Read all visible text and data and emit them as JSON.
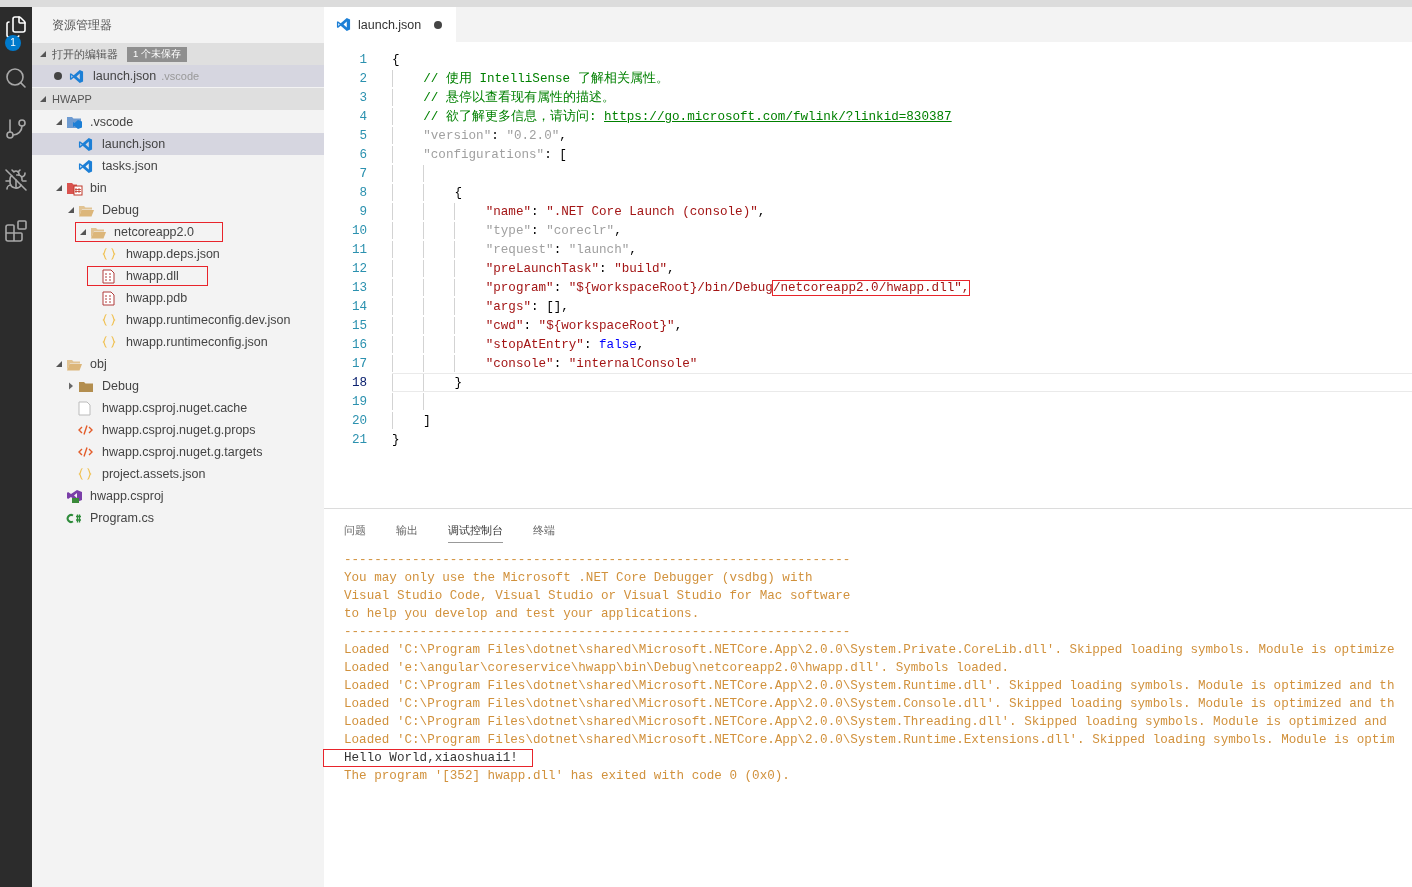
{
  "activity_bar": {
    "items": [
      {
        "kind": "files",
        "selected": true,
        "badge": "1"
      },
      {
        "kind": "search",
        "selected": false
      },
      {
        "kind": "git",
        "selected": false
      },
      {
        "kind": "debug",
        "selected": false
      },
      {
        "kind": "extensions",
        "selected": false
      }
    ]
  },
  "sidebar": {
    "title": "资源管理器",
    "open_editors": {
      "title": "打开的编辑器",
      "badge": "1 个未保存",
      "expanded": true,
      "items": [
        {
          "label": "launch.json",
          "description": ".vscode",
          "kind": "vscode",
          "dirty": true,
          "selected": true
        }
      ]
    },
    "workspace": {
      "title": "HWAPP",
      "expanded": true,
      "tree": [
        {
          "label": ".vscode",
          "kind": "vscode-folder",
          "expanded": true,
          "selected": false,
          "children": [
            {
              "label": "launch.json",
              "kind": "vscode",
              "selected": true
            },
            {
              "label": "tasks.json",
              "kind": "vscode",
              "selected": false
            }
          ]
        },
        {
          "label": "bin",
          "kind": "bin-folder",
          "expanded": true,
          "selected": false,
          "children": [
            {
              "label": "Debug",
              "kind": "folder",
              "expanded": true,
              "selected": false,
              "children": [
                {
                  "label": "netcoreapp2.0",
                  "kind": "folder",
                  "expanded": true,
                  "selected": false,
                  "annotated": true,
                  "children": [
                    {
                      "label": "hwapp.deps.json",
                      "kind": "braces",
                      "selected": false
                    },
                    {
                      "label": "hwapp.dll",
                      "kind": "binary",
                      "selected": false,
                      "annotated": true
                    },
                    {
                      "label": "hwapp.pdb",
                      "kind": "binary",
                      "selected": false
                    },
                    {
                      "label": "hwapp.runtimeconfig.dev.json",
                      "kind": "braces",
                      "selected": false
                    },
                    {
                      "label": "hwapp.runtimeconfig.json",
                      "kind": "braces",
                      "selected": false
                    }
                  ]
                }
              ]
            }
          ]
        },
        {
          "label": "obj",
          "kind": "folder",
          "expanded": true,
          "selected": false,
          "children": [
            {
              "label": "Debug",
              "kind": "folder",
              "expanded": false,
              "selected": false
            },
            {
              "label": "hwapp.csproj.nuget.cache",
              "kind": "plain",
              "selected": false
            },
            {
              "label": "hwapp.csproj.nuget.g.props",
              "kind": "xml",
              "selected": false
            },
            {
              "label": "hwapp.csproj.nuget.g.targets",
              "kind": "xml",
              "selected": false
            },
            {
              "label": "project.assets.json",
              "kind": "braces",
              "selected": false
            }
          ]
        },
        {
          "label": "hwapp.csproj",
          "kind": "csproj",
          "selected": false
        },
        {
          "label": "Program.cs",
          "kind": "csharp",
          "selected": false
        }
      ]
    }
  },
  "editor": {
    "tabs": [
      {
        "label": "launch.json",
        "kind": "vscode",
        "dirty": true,
        "selected": true
      }
    ],
    "lines": [
      {
        "number": "1",
        "tokens": [
          {
            "kind": "punct",
            "text": "{"
          }
        ],
        "children": [
          {
            "number": "2",
            "tokens": [
              {
                "kind": "comment",
                "text": "// 使用 IntelliSense 了解相关属性。"
              }
            ]
          },
          {
            "number": "3",
            "tokens": [
              {
                "kind": "comment",
                "text": "// 悬停以查看现有属性的描述。"
              }
            ]
          },
          {
            "number": "4",
            "tokens": [
              {
                "kind": "comment",
                "text": "// 欲了解更多信息，请访问: "
              },
              {
                "kind": "link",
                "text": "https://go.microsoft.com/fwlink/?linkid=830387"
              }
            ]
          },
          {
            "number": "5",
            "tokens": [
              {
                "kind": "dim",
                "text": "\"version\""
              },
              {
                "kind": "punct",
                "text": ": "
              },
              {
                "kind": "dim",
                "text": "\"0.2.0\""
              },
              {
                "kind": "punct",
                "text": ","
              }
            ]
          },
          {
            "number": "6",
            "tokens": [
              {
                "kind": "dim",
                "text": "\"configurations\""
              },
              {
                "kind": "punct",
                "text": ": ["
              }
            ],
            "children": [
              {
                "number": "7"
              },
              {
                "number": "8",
                "tokens": [
                  {
                    "kind": "punct",
                    "text": "{"
                  }
                ],
                "children": [
                  {
                    "number": "9",
                    "tokens": [
                      {
                        "kind": "key",
                        "text": "\"name\""
                      },
                      {
                        "kind": "punct",
                        "text": ": "
                      },
                      {
                        "kind": "string",
                        "text": "\".NET Core Launch (console)\""
                      },
                      {
                        "kind": "punct",
                        "text": ","
                      }
                    ]
                  },
                  {
                    "number": "10",
                    "tokens": [
                      {
                        "kind": "dim",
                        "text": "\"type\""
                      },
                      {
                        "kind": "punct",
                        "text": ": "
                      },
                      {
                        "kind": "dim",
                        "text": "\"coreclr\""
                      },
                      {
                        "kind": "punct",
                        "text": ","
                      }
                    ]
                  },
                  {
                    "number": "11",
                    "tokens": [
                      {
                        "kind": "dim",
                        "text": "\"request\""
                      },
                      {
                        "kind": "punct",
                        "text": ": "
                      },
                      {
                        "kind": "dim",
                        "text": "\"launch\""
                      },
                      {
                        "kind": "punct",
                        "text": ","
                      }
                    ]
                  },
                  {
                    "number": "12",
                    "tokens": [
                      {
                        "kind": "key",
                        "text": "\"preLaunchTask\""
                      },
                      {
                        "kind": "punct",
                        "text": ": "
                      },
                      {
                        "kind": "string",
                        "text": "\"build\""
                      },
                      {
                        "kind": "punct",
                        "text": ","
                      }
                    ]
                  },
                  {
                    "number": "13",
                    "tokens": [
                      {
                        "kind": "key",
                        "text": "\"program\""
                      },
                      {
                        "kind": "punct",
                        "text": ": "
                      },
                      {
                        "kind": "string",
                        "text": "\"${workspaceRoot}/bin/Debug"
                      },
                      {
                        "kind": "string",
                        "text": "/netcoreapp2.0/hwapp.dll\",",
                        "boxed": true
                      }
                    ]
                  },
                  {
                    "number": "14",
                    "tokens": [
                      {
                        "kind": "key",
                        "text": "\"args\""
                      },
                      {
                        "kind": "punct",
                        "text": ": [],"
                      }
                    ]
                  },
                  {
                    "number": "15",
                    "tokens": [
                      {
                        "kind": "key",
                        "text": "\"cwd\""
                      },
                      {
                        "kind": "punct",
                        "text": ": "
                      },
                      {
                        "kind": "string",
                        "text": "\"${workspaceRoot}\""
                      },
                      {
                        "kind": "punct",
                        "text": ","
                      }
                    ]
                  },
                  {
                    "number": "16",
                    "tokens": [
                      {
                        "kind": "key",
                        "text": "\"stopAtEntry\""
                      },
                      {
                        "kind": "punct",
                        "text": ": "
                      },
                      {
                        "kind": "bool",
                        "text": "false"
                      },
                      {
                        "kind": "punct",
                        "text": ","
                      }
                    ]
                  },
                  {
                    "number": "17",
                    "tokens": [
                      {
                        "kind": "key",
                        "text": "\"console\""
                      },
                      {
                        "kind": "punct",
                        "text": ": "
                      },
                      {
                        "kind": "string",
                        "text": "\"internalConsole\""
                      }
                    ]
                  }
                ]
              },
              {
                "number": "18",
                "current": true,
                "tokens": [
                  {
                    "kind": "punct",
                    "text": "}"
                  }
                ]
              },
              {
                "number": "19"
              }
            ]
          },
          {
            "number": "20",
            "tokens": [
              {
                "kind": "punct",
                "text": "]"
              }
            ]
          }
        ]
      },
      {
        "number": "21",
        "tokens": [
          {
            "kind": "punct",
            "text": "}"
          }
        ]
      }
    ]
  },
  "panel": {
    "tabs": [
      {
        "label": "问题",
        "selected": false
      },
      {
        "label": "输出",
        "selected": false
      },
      {
        "label": "调试控制台",
        "selected": true
      },
      {
        "label": "终端",
        "selected": false
      }
    ],
    "console": [
      {
        "kind": "warning",
        "text": "-------------------------------------------------------------------"
      },
      {
        "kind": "warning",
        "text": "You may only use the Microsoft .NET Core Debugger (vsdbg) with"
      },
      {
        "kind": "warning",
        "text": "Visual Studio Code, Visual Studio or Visual Studio for Mac software"
      },
      {
        "kind": "warning",
        "text": "to help you develop and test your applications."
      },
      {
        "kind": "warning",
        "text": "-------------------------------------------------------------------"
      },
      {
        "kind": "warning",
        "text": "Loaded 'C:\\Program Files\\dotnet\\shared\\Microsoft.NETCore.App\\2.0.0\\System.Private.CoreLib.dll'. Skipped loading symbols. Module is optimize"
      },
      {
        "kind": "warning",
        "text": "Loaded 'e:\\angular\\coreservice\\hwapp\\bin\\Debug\\netcoreapp2.0\\hwapp.dll'. Symbols loaded."
      },
      {
        "kind": "warning",
        "text": "Loaded 'C:\\Program Files\\dotnet\\shared\\Microsoft.NETCore.App\\2.0.0\\System.Runtime.dll'. Skipped loading symbols. Module is optimized and th"
      },
      {
        "kind": "warning",
        "text": "Loaded 'C:\\Program Files\\dotnet\\shared\\Microsoft.NETCore.App\\2.0.0\\System.Console.dll'. Skipped loading symbols. Module is optimized and th"
      },
      {
        "kind": "warning",
        "text": "Loaded 'C:\\Program Files\\dotnet\\shared\\Microsoft.NETCore.App\\2.0.0\\System.Threading.dll'. Skipped loading symbols. Module is optimized and"
      },
      {
        "kind": "warning",
        "text": "Loaded 'C:\\Program Files\\dotnet\\shared\\Microsoft.NETCore.App\\2.0.0\\System.Runtime.Extensions.dll'. Skipped loading symbols. Module is optim"
      },
      {
        "kind": "output",
        "text": "Hello World,xiaoshuai1!",
        "annotated": true
      },
      {
        "kind": "warning",
        "text": "The program '[352] hwapp.dll' has exited with code 0 (0x0)."
      }
    ]
  }
}
